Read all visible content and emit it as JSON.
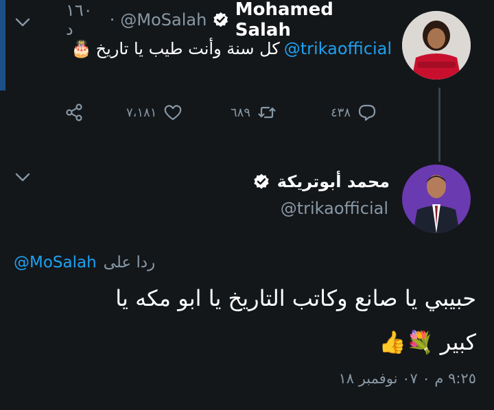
{
  "parent_tweet": {
    "author_name": "Mohamed Salah",
    "handle": "@MoSalah",
    "time": "١٦٠ د",
    "mention": "@trikaofficial",
    "text": "كل سنة وأنت طيب يا تاريخ",
    "emoji": "🎂",
    "replies": "٤٣٨",
    "retweets": "٦٨٩",
    "likes": "٧،١٨١"
  },
  "main_tweet": {
    "author_name": "محمد أبوتريكة",
    "handle": "@trikaofficial",
    "reply_prefix": "ردا على",
    "reply_to": "@MoSalah",
    "text_line1": "حبيبي يا صانع وكاتب التاريخ يا ابو مكه يا",
    "text_line2": "كبير",
    "emojis": "👍💐",
    "timestamp": "٩:٢٥ م ٠ ٠٧ نوفمبر ١٨"
  },
  "colors": {
    "background": "#14171a",
    "accent": "#1da1f2",
    "muted": "#8899a6",
    "thread_line": "#38444d"
  },
  "icons": [
    "chevron-down-icon",
    "verified-badge-icon",
    "share-icon",
    "heart-icon",
    "retweet-icon",
    "reply-icon"
  ]
}
